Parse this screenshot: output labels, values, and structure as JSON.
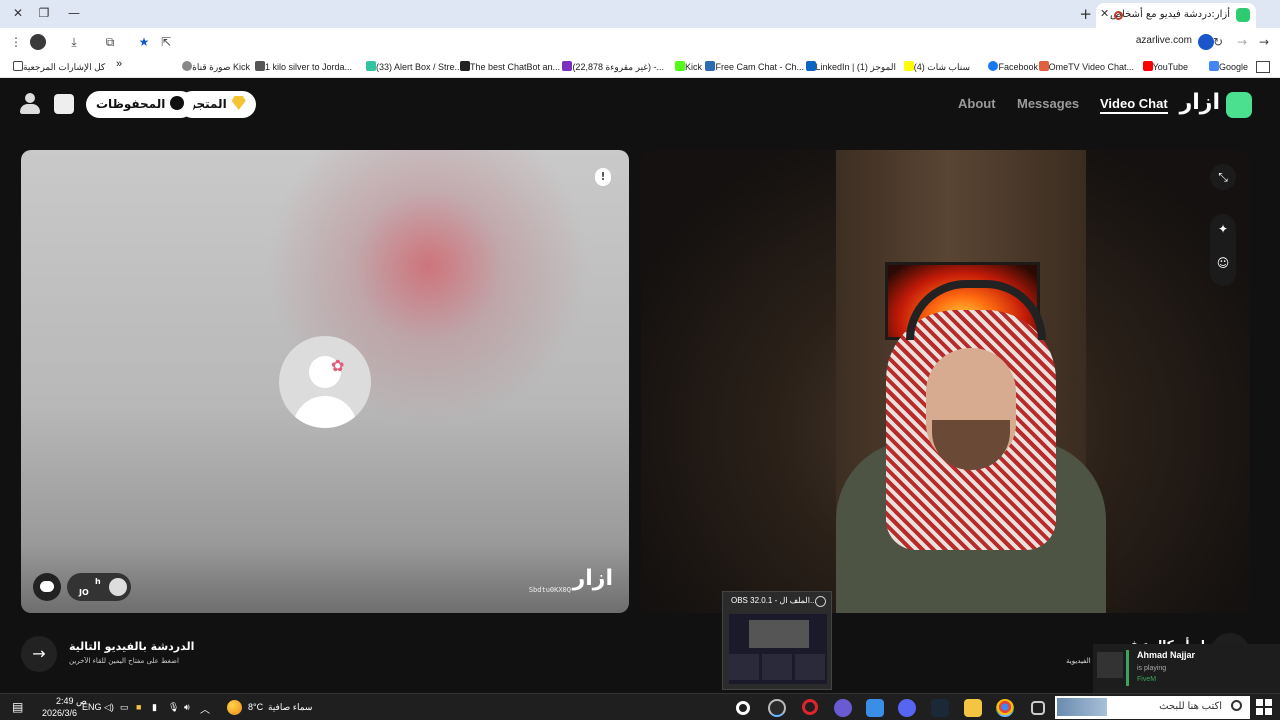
{
  "browser": {
    "tab_title": "أزار:دردشة فيديو مع أشخاص",
    "url": "azarlive.com",
    "bookmarks": [
      {
        "label": "Google",
        "color": "#4285f4"
      },
      {
        "label": "YouTube",
        "color": "#ff0000"
      },
      {
        "label": "OmeTV Video Chat...",
        "color": "#e06040"
      },
      {
        "label": "Facebook",
        "color": "#1877f2"
      },
      {
        "label": "(4) سناب شات",
        "color": "#fffc00"
      },
      {
        "label": "LinkedIn | (1) الموجز",
        "color": "#0a66c2"
      },
      {
        "label": "Free Cam Chat - Ch...",
        "color": "#2b6cb0"
      },
      {
        "label": "Kick",
        "color": "#53fc18"
      },
      {
        "label": "(22,878 غير مقروءة) -...",
        "color": "#7b2fbf"
      },
      {
        "label": "The best ChatBot an...",
        "color": "#222222"
      },
      {
        "label": "(33) Alert Box / Stre...",
        "color": "#31c3a2"
      },
      {
        "label": "1 kilo silver to Jorda...",
        "color": "#555555"
      },
      {
        "label": "صورة قناة Kick",
        "color": "#888888"
      }
    ],
    "all_bookmarks": "كل الإشارات المرجعية"
  },
  "app": {
    "logo_text": "ازار",
    "nav": {
      "video_chat": "Video Chat",
      "messages": "Messages",
      "about": "About"
    },
    "store_label": "المتجر",
    "saved_label": "المحفوظات",
    "left_panel": {
      "watermark": "ازار",
      "id_text": "Sbdtu0KX0Q",
      "peer_name": "h",
      "peer_country": "JO"
    },
    "next": {
      "title": "الدردشة بالفيديو التالية",
      "subtitle": "اضغط على مفتاح اليمين للقاء الآخرين"
    },
    "right_partial": "ابدأ مكالمة فيديو",
    "right_note": "الفيديوية"
  },
  "obs": {
    "title": "OBS 32.0.1 - الملف ال..."
  },
  "discord": {
    "name": "Ahmad Najjar",
    "status": "is playing",
    "game": "FiveM"
  },
  "taskbar": {
    "search_placeholder": "اكتب هنا للبحث",
    "weather_temp": "8°C",
    "weather_text": "سماء صافية",
    "language": "ENG",
    "time": "2:49 ص",
    "date": "2026/3/6"
  }
}
